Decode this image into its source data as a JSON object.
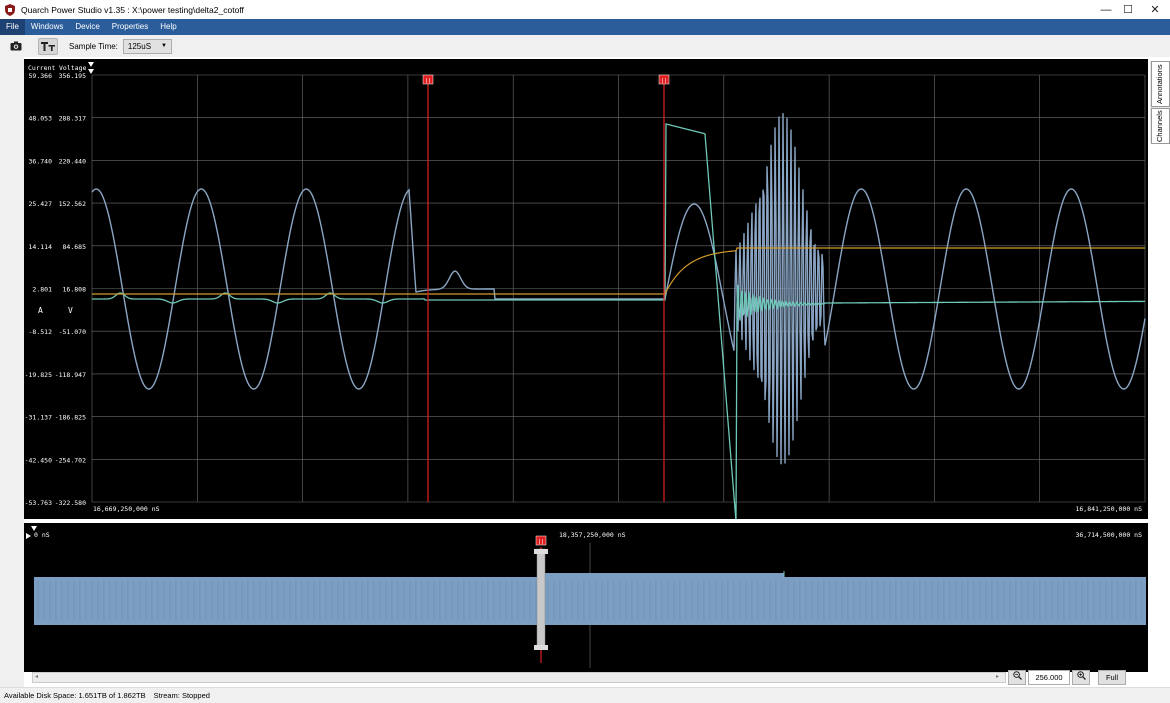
{
  "window": {
    "title": "Quarch Power Studio v1.35 : X:\\power testing\\delta2_cotoff",
    "controls": [
      "—",
      "☐",
      "✕"
    ]
  },
  "menu": {
    "items": [
      "File",
      "Windows",
      "Device",
      "Properties",
      "Help"
    ]
  },
  "toolbar": {
    "sample_time_label": "Sample Time:",
    "sample_time_value": "125uS"
  },
  "colors": {
    "voltage_trace": "#8aa6c4",
    "current_trace": "#6fc9b8",
    "avg_trace": "#d19a2e",
    "cursor": "#e02020",
    "overview_fill": "#7b9ec2",
    "menubar": "#2b5d9b"
  },
  "main_chart": {
    "axis_headers": [
      "Current",
      "Voltage"
    ],
    "current_ticks": [
      "59.366",
      "48.053",
      "36.740",
      "25.427",
      "14.114",
      "2.801",
      "-8.512",
      "-19.825",
      "-31.137",
      "-42.450",
      "-53.763"
    ],
    "voltage_ticks": [
      "356.195",
      "288.317",
      "220.440",
      "152.562",
      "84.685",
      "16.808",
      "-51.070",
      "-118.947",
      "-186.825",
      "-254.702",
      "-322.580"
    ],
    "unit_current": "A",
    "unit_voltage": "V",
    "time_start": "16,669,250,000 nS",
    "time_end": "16,841,250,000 nS",
    "marker_label": "||"
  },
  "overview": {
    "time_start": "0 nS",
    "time_mid": "18,357,250,000 nS",
    "time_end": "36,714,500,000 nS",
    "marker_label": "||"
  },
  "side_tabs": [
    "Annotations",
    "Channels"
  ],
  "zoom": {
    "out_icon": "🔍",
    "value": "256.000",
    "in_icon": "🔍",
    "full_label": "Full"
  },
  "status": {
    "disk_space": "Available Disk Space: 1.651TB of 1.862TB",
    "stream": "Stream:  Stopped"
  }
}
